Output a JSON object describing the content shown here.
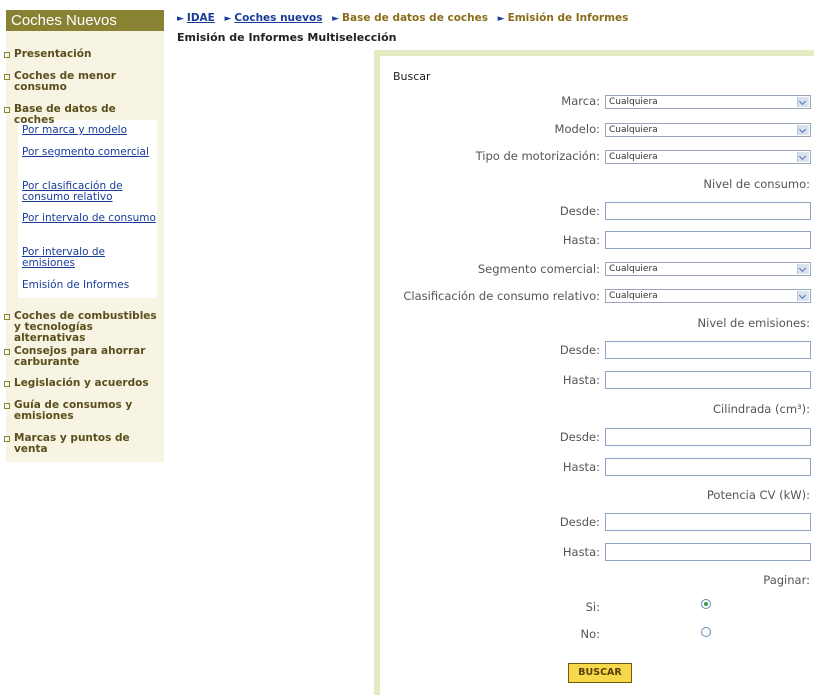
{
  "sidebar": {
    "title": "Coches Nuevos",
    "items": [
      {
        "label": "Presentación"
      },
      {
        "label": "Coches de menor consumo"
      },
      {
        "label": "Base de datos de coches"
      },
      {
        "label": "Coches de combustibles y tecnologías alternativas"
      },
      {
        "label": "Consejos para ahorrar carburante"
      },
      {
        "label": "Legislación y acuerdos"
      },
      {
        "label": "Guía de consumos y emisiones"
      },
      {
        "label": "Marcas y puntos de venta"
      }
    ],
    "subitems": [
      {
        "label": "Por marca y modelo"
      },
      {
        "label": "Por segmento comercial"
      },
      {
        "label": "Por clasificación de consumo relativo"
      },
      {
        "label": "Por intervalo de consumo"
      },
      {
        "label": "Por intervalo de emisiones"
      },
      {
        "label": "Emisión de Informes"
      }
    ]
  },
  "breadcrumb": [
    "IDAE",
    "Coches nuevos",
    "Base de datos de coches",
    "Emisión de Informes"
  ],
  "page_title": "Emisión de Informes Multiselección",
  "form": {
    "title": "Buscar",
    "marca_label": "Marca:",
    "marca_value": "Cualquiera",
    "modelo_label": "Modelo:",
    "modelo_value": "Cualquiera",
    "motor_label": "Tipo de motorización:",
    "motor_value": "Cualquiera",
    "consumo_heading": "Nivel de consumo:",
    "segmento_label": "Segmento comercial:",
    "segmento_value": "Cualquiera",
    "clasif_label": "Clasificación de consumo relativo:",
    "clasif_value": "Cualquiera",
    "emisiones_heading": "Nivel de emisiones:",
    "cilindrada_heading": "Cilindrada (cm³):",
    "potencia_heading": "Potencia CV (kW):",
    "desde_label": "Desde:",
    "hasta_label": "Hasta:",
    "paginar_heading": "Paginar:",
    "si_label": "Si:",
    "no_label": "No:",
    "paginar_selected": "Si",
    "submit_label": "BUSCAR"
  }
}
